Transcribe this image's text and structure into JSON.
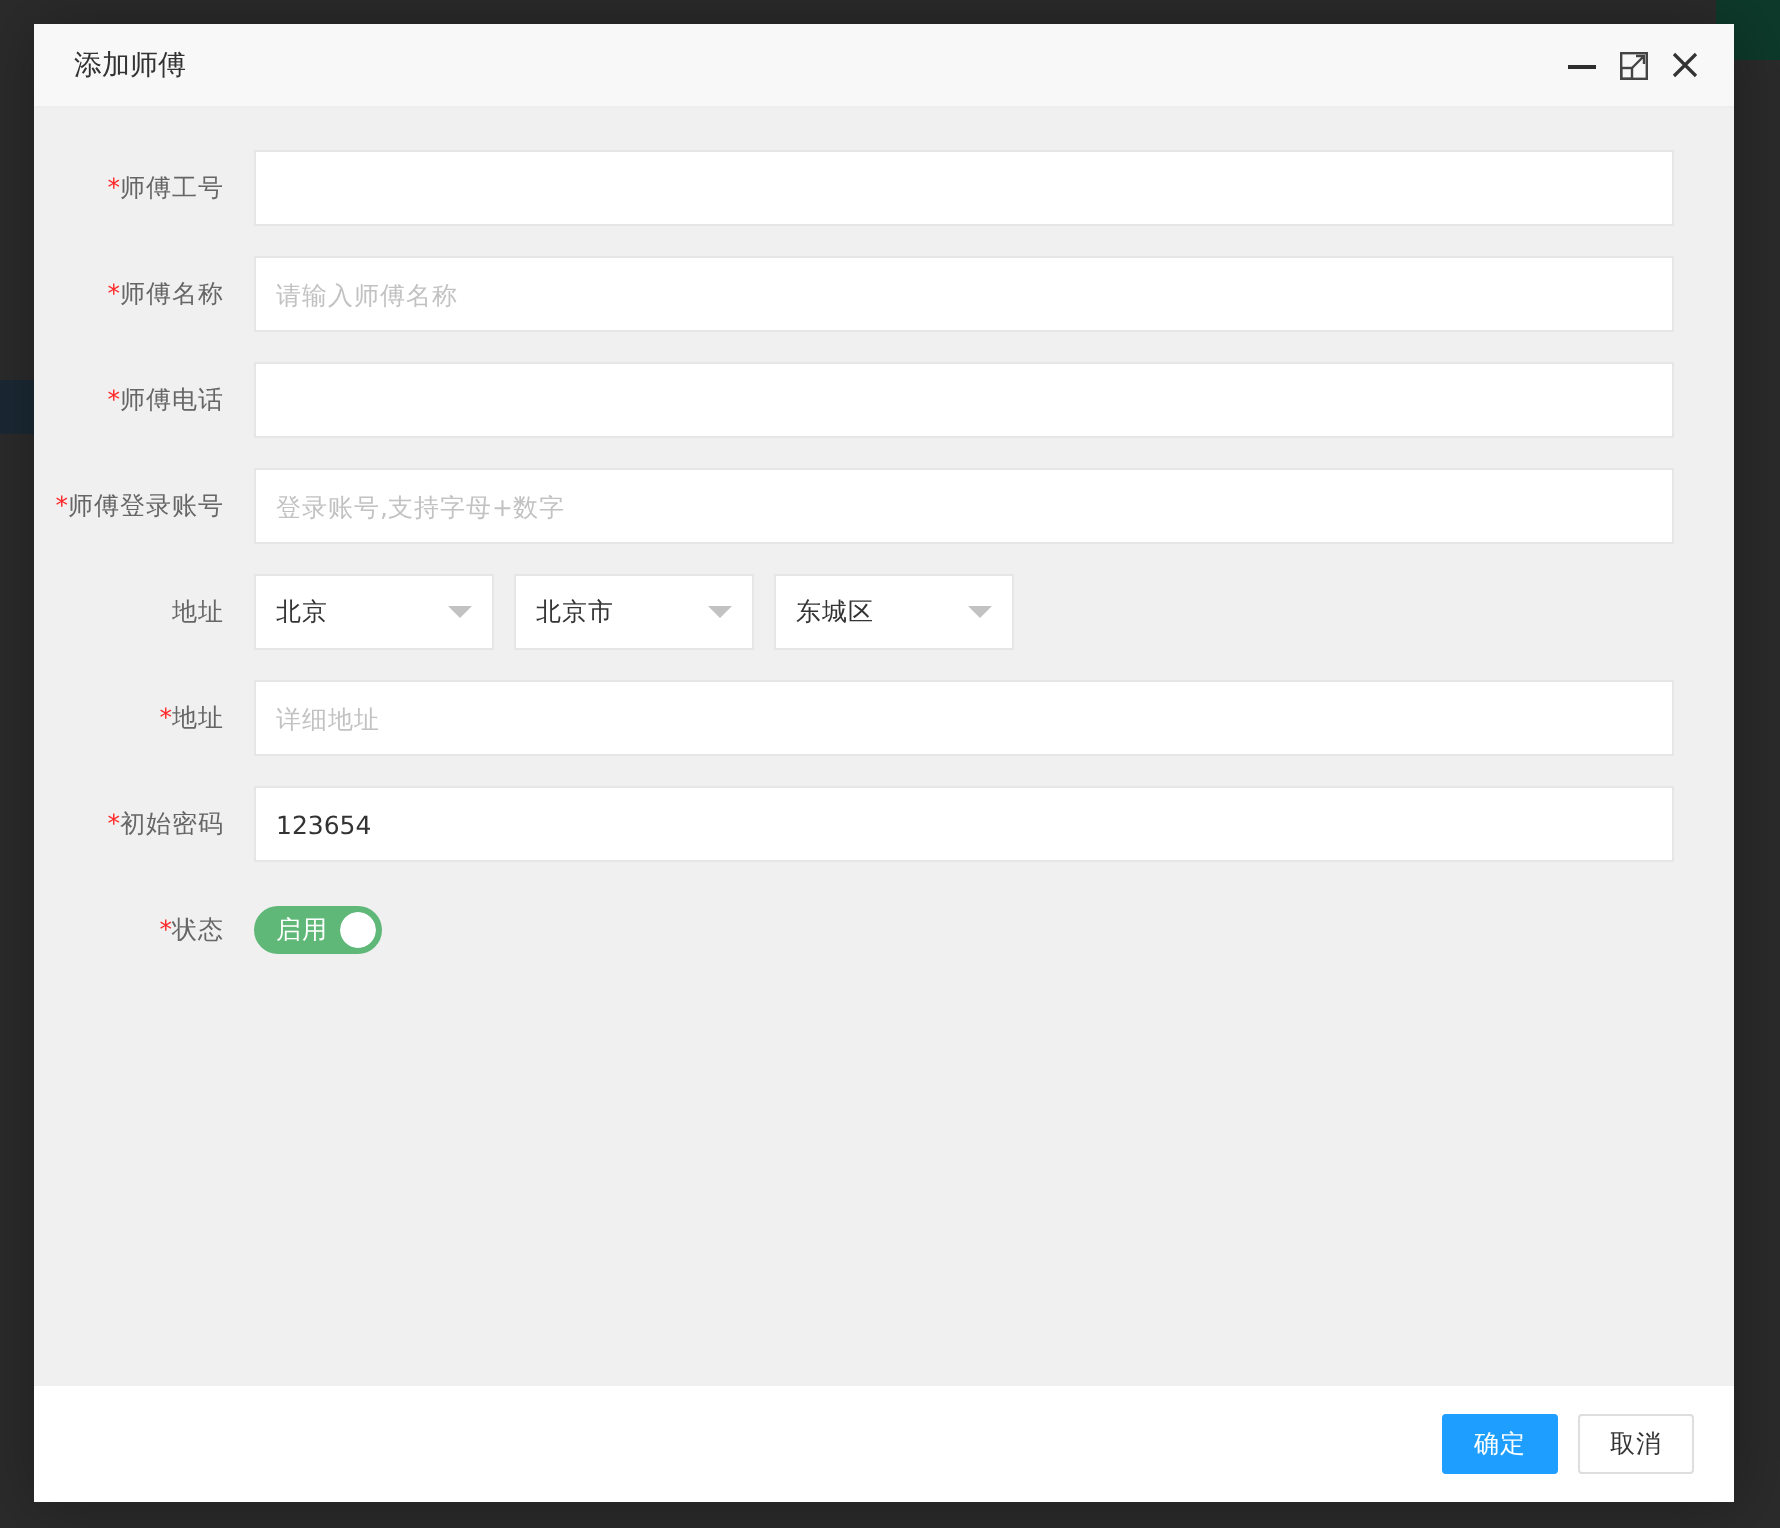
{
  "dialog": {
    "title": "添加师傅"
  },
  "fields": [
    {
      "kind": "text",
      "mark": "*",
      "label": "师傅工号"
    },
    {
      "kind": "text",
      "mark": "*",
      "label": "师傅名称",
      "placeholder": "请输入师傅名称"
    },
    {
      "kind": "text",
      "mark": "*",
      "label": "师傅电话"
    },
    {
      "kind": "text",
      "mark": "*",
      "label": "师傅登录账号",
      "placeholder": "登录账号,支持字母+数字"
    },
    {
      "kind": "selects",
      "label": "地址",
      "selects": [
        {
          "value": "北京"
        },
        {
          "value": "北京市"
        },
        {
          "value": "东城区"
        }
      ]
    },
    {
      "kind": "text",
      "mark": "*",
      "label": "地址",
      "placeholder": "详细地址"
    },
    {
      "kind": "text",
      "mark": "*",
      "label": "初始密码",
      "value": "123654"
    },
    {
      "kind": "switch",
      "mark": "*",
      "label": "状态",
      "on": true,
      "text": "启用"
    }
  ],
  "buttons": [
    {
      "kind": "primary",
      "label": "确定"
    },
    {
      "kind": "default",
      "label": "取消"
    }
  ]
}
